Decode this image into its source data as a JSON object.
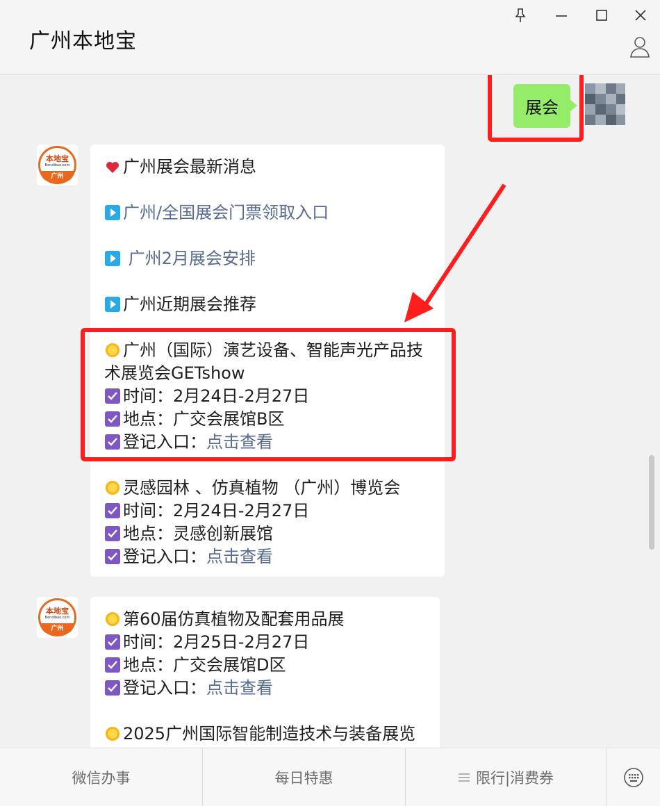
{
  "window": {
    "title": "广州本地宝",
    "controls": [
      "pin-icon",
      "minimize-icon",
      "maximize-icon",
      "close-icon",
      "user-icon"
    ]
  },
  "chat": {
    "user_message": "展会",
    "bot_avatar": {
      "brand": "本地宝",
      "domain": "Bendibao.com",
      "city": "广州"
    },
    "bubble1": {
      "heading": "广州展会最新消息",
      "links": [
        "广州/全国展会门票领取入口",
        "广州2月展会安排",
        "广州近期展会推荐"
      ],
      "events": [
        {
          "name": "广州（国际）演艺设备、智能声光产品技术展览会GETshow",
          "time": "时间：2月24日-2月27日",
          "place": "地点：广交会展馆B区",
          "register_label": "登记入口：",
          "register_link": "点击查看"
        },
        {
          "name": "灵感园林 、仿真植物 （广州）博览会",
          "time": "时间：2月24日-2月27日",
          "place": "地点：灵感创新展馆",
          "register_label": "登记入口：",
          "register_link": "点击查看"
        }
      ]
    },
    "bubble2": {
      "events": [
        {
          "name": "第60届仿真植物及配套用品展",
          "time": "时间：2月25日-2月27日",
          "place": "地点：广交会展馆D区",
          "register_label": "登记入口：",
          "register_link": "点击查看"
        },
        {
          "name": "2025广州国际智能制造技术与装备展览"
        }
      ]
    }
  },
  "menu": {
    "items": [
      "微信办事",
      "每日特惠",
      "限行|消费券"
    ],
    "keyboard": "keyboard-icon"
  },
  "colors": {
    "bubble_green": "#95ec69",
    "link": "#576b95",
    "highlight": "#ff1e1e",
    "check": "#7e57c2",
    "play": "#29a9e6"
  }
}
